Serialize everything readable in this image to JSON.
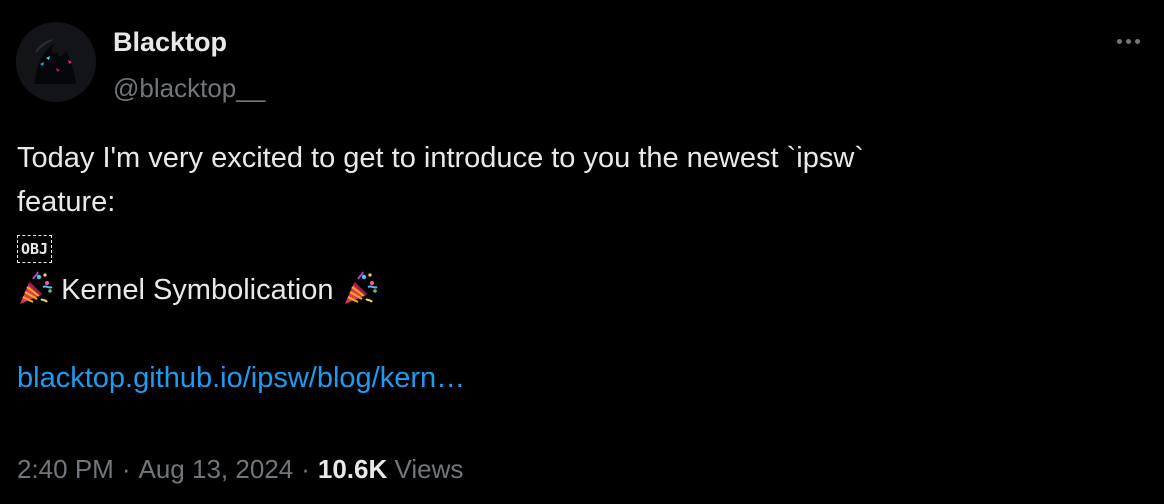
{
  "author": {
    "display_name": "Blacktop",
    "handle": "@blacktop__"
  },
  "more_icon": "more-horizontal-icon",
  "tweet": {
    "line1": "Today I'm very excited to get to introduce to you the newest `ipsw`",
    "line2": "feature:",
    "object_glyph": "OBJ",
    "headline": "Kernel Symbolication",
    "headline_icon": "party-popper-icon",
    "link": "blacktop.github.io/ipsw/blog/kern…"
  },
  "meta": {
    "time": "2:40 PM",
    "separator": "·",
    "date": "Aug 13, 2024",
    "views_count": "10.6K",
    "views_label": "Views"
  },
  "colors": {
    "background": "#000000",
    "text": "#e7e9ea",
    "secondary": "#71767b",
    "link": "#1d9bf0"
  }
}
